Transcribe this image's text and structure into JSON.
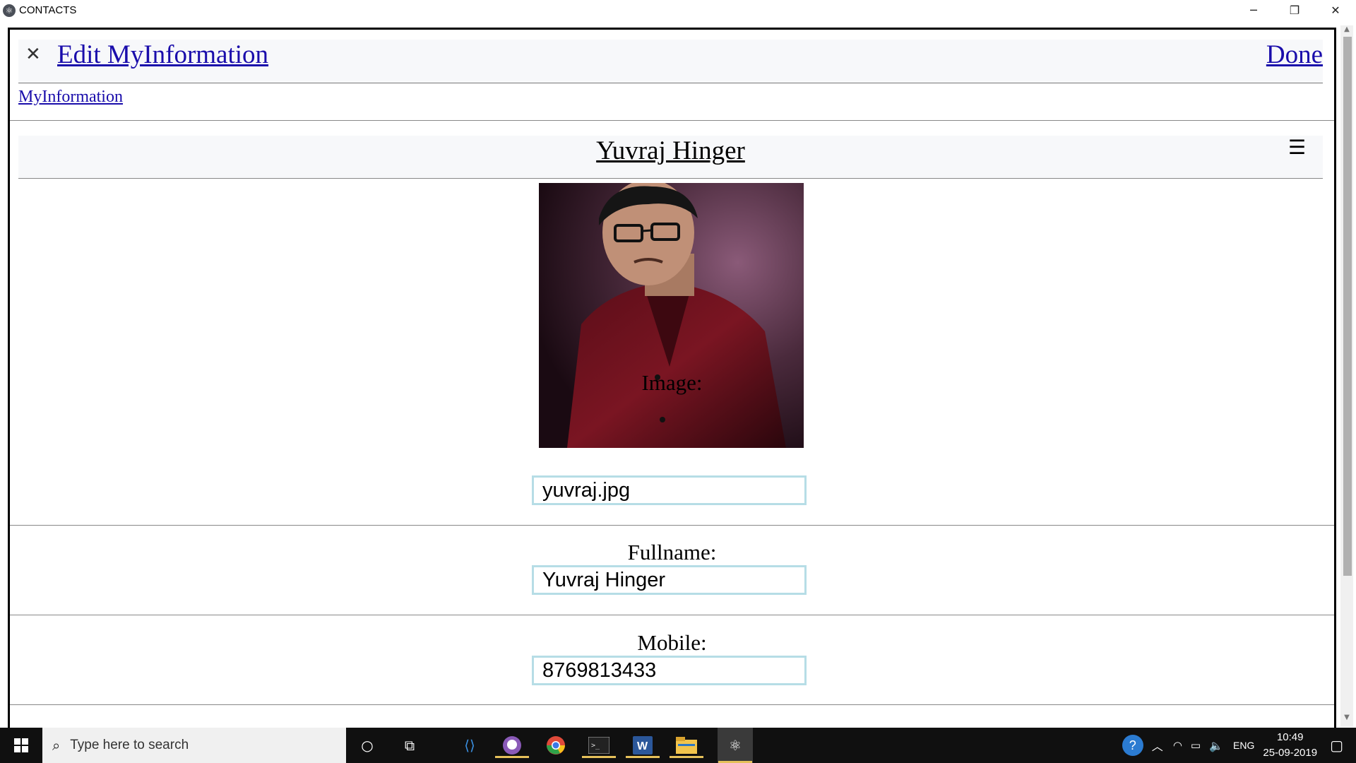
{
  "window": {
    "title": "CONTACTS"
  },
  "header": {
    "title": "Edit MyInformation",
    "done_label": "Done"
  },
  "breadcrumb": {
    "label": "MyInformation"
  },
  "contact": {
    "name": "Yuvraj Hinger"
  },
  "fields": {
    "image": {
      "label": "Image:",
      "value": "yuvraj.jpg"
    },
    "fullname": {
      "label": "Fullname:",
      "value": "Yuvraj Hinger"
    },
    "mobile": {
      "label": "Mobile:",
      "value": "8769813433"
    }
  },
  "taskbar": {
    "search_placeholder": "Type here to search",
    "language": "ENG",
    "time": "10:49",
    "date": "25-09-2019"
  },
  "icons": [
    "app-icon",
    "close-icon",
    "menu-icon",
    "windows-start-icon",
    "search-icon",
    "cortana-icon",
    "task-view-icon",
    "vscode-icon",
    "github-icon",
    "chrome-icon",
    "terminal-icon",
    "word-icon",
    "file-explorer-icon",
    "electron-icon",
    "help-icon",
    "chevron-up-icon",
    "wifi-icon",
    "battery-icon",
    "volume-icon",
    "notification-icon"
  ]
}
